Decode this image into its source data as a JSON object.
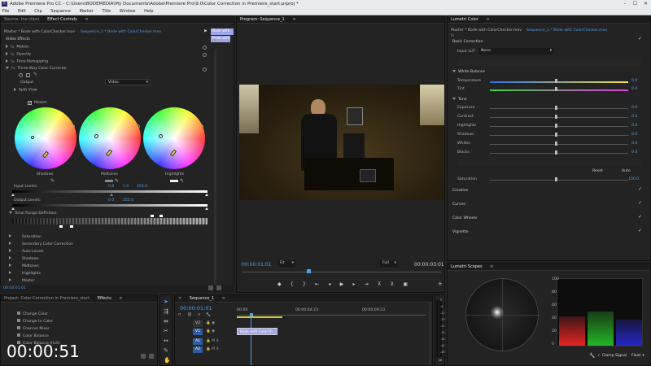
{
  "window": {
    "title": "Adobe Premiere Pro CC - C:\\Users\\BODEMEDIA\\My Documents\\Adobe\\Premiere Pro\\9.0\\Color Correction in Premiere_start.prproj *",
    "app_badge": "Pr",
    "controls": [
      "–",
      "☐",
      "✕"
    ]
  },
  "menu": [
    "File",
    "Edit",
    "Clip",
    "Sequence",
    "Marker",
    "Title",
    "Window",
    "Help"
  ],
  "effect_controls": {
    "tabs": [
      "Source: (no clips)",
      "Effect Controls",
      "≡"
    ],
    "breadcrumb": "Master * Bode with ColorChecker.mov",
    "clip_ref": "Sequence_1 * Bode with ColorChecker.mov",
    "tooltip": "Bode with",
    "mini_clip": "Bode with",
    "video_effects_label": "Video Effects",
    "fx_rows": [
      "Motion",
      "Opacity",
      "Time Remapping",
      "Three-Way Color Corrector"
    ],
    "output_label": "Output",
    "output_value": "Video",
    "split_view": "Split View",
    "master_label": "Master",
    "wheel_labels": [
      "Shadows",
      "Midtones",
      "Highlights"
    ],
    "input_levels_label": "Input Levels:",
    "input_levels": [
      "0.0",
      "1.0",
      "255.0"
    ],
    "output_levels_label": "Output Levels:",
    "output_levels": [
      "0.0",
      "255.0"
    ],
    "tonal_range": "Tonal Range Definition",
    "sections": [
      "Saturation",
      "Secondary Color Correction",
      "Auto Levels",
      "Shadows",
      "Midtones",
      "Highlights",
      "Master",
      "Master Levels"
    ],
    "timecode": "00:00:01:01"
  },
  "program": {
    "tab": "Program: Sequence_1",
    "timecode_left": "00:00:01:01",
    "fit": "Fit",
    "quality": "Full",
    "timecode_right": "00:00:03:01"
  },
  "lumetri_color": {
    "tab": "Lumetri Color",
    "clip_master": "Master * Bode with ColorChecker.mov",
    "clip_seq": "Sequence_1 * Bode with ColorChecker.mov",
    "fx_label": "fx",
    "basic_correction": "Basic Correction",
    "input_lut_label": "Input LUT",
    "input_lut_value": "None",
    "white_balance": "White Balance",
    "temperature_label": "Temperature",
    "temperature": "0.0",
    "tint_label": "Tint",
    "tint": "0.0",
    "tone": "Tone",
    "tone_rows": [
      {
        "label": "Exposure",
        "value": "0.0"
      },
      {
        "label": "Contrast",
        "value": "0.0"
      },
      {
        "label": "Highlights",
        "value": "0.0"
      },
      {
        "label": "Shadows",
        "value": "0.0"
      },
      {
        "label": "Whites",
        "value": "0.0"
      },
      {
        "label": "Blacks",
        "value": "0.0"
      }
    ],
    "reset_label": "Reset",
    "auto_label": "Auto",
    "saturation_label": "Saturation",
    "saturation": "100.0",
    "sections": [
      "Creative",
      "Curves",
      "Color Wheels",
      "Vignette"
    ]
  },
  "lumetri_scopes": {
    "tab": "Lumetri Scopes",
    "scale": [
      "100",
      "80",
      "60",
      "40",
      "20",
      "0"
    ],
    "clamp_signal": "Clamp Signal",
    "float": "Float"
  },
  "project": {
    "tabs": [
      "Project: Color Correction in Premiere_start",
      "Effects"
    ],
    "items": [
      "Change Color",
      "Change to Color",
      "Channel Mixer",
      "Color Balance",
      "Color Balance (HLS)"
    ]
  },
  "timeline": {
    "tab": "Sequence_1",
    "timecode": "00:00:01:01",
    "ruler": [
      "00:00",
      "00:00:04:23",
      "00:00:09:23"
    ],
    "video_tracks": [
      "V2",
      "V1"
    ],
    "audio_tracks": [
      "A1",
      "A2"
    ],
    "clip_name": "Bode with ColorCh",
    "meter_scale": [
      "0",
      "-6",
      "-12",
      "-18",
      "-24",
      "-30",
      "-36",
      "-42",
      "-48",
      "dB"
    ]
  },
  "overlay_timer": "00:00:51",
  "colors": {
    "accent_blue": "#4f9fe9",
    "panel": "#232323",
    "bar": "#1b1b1b",
    "clip_purple": "#9ea5e6"
  }
}
